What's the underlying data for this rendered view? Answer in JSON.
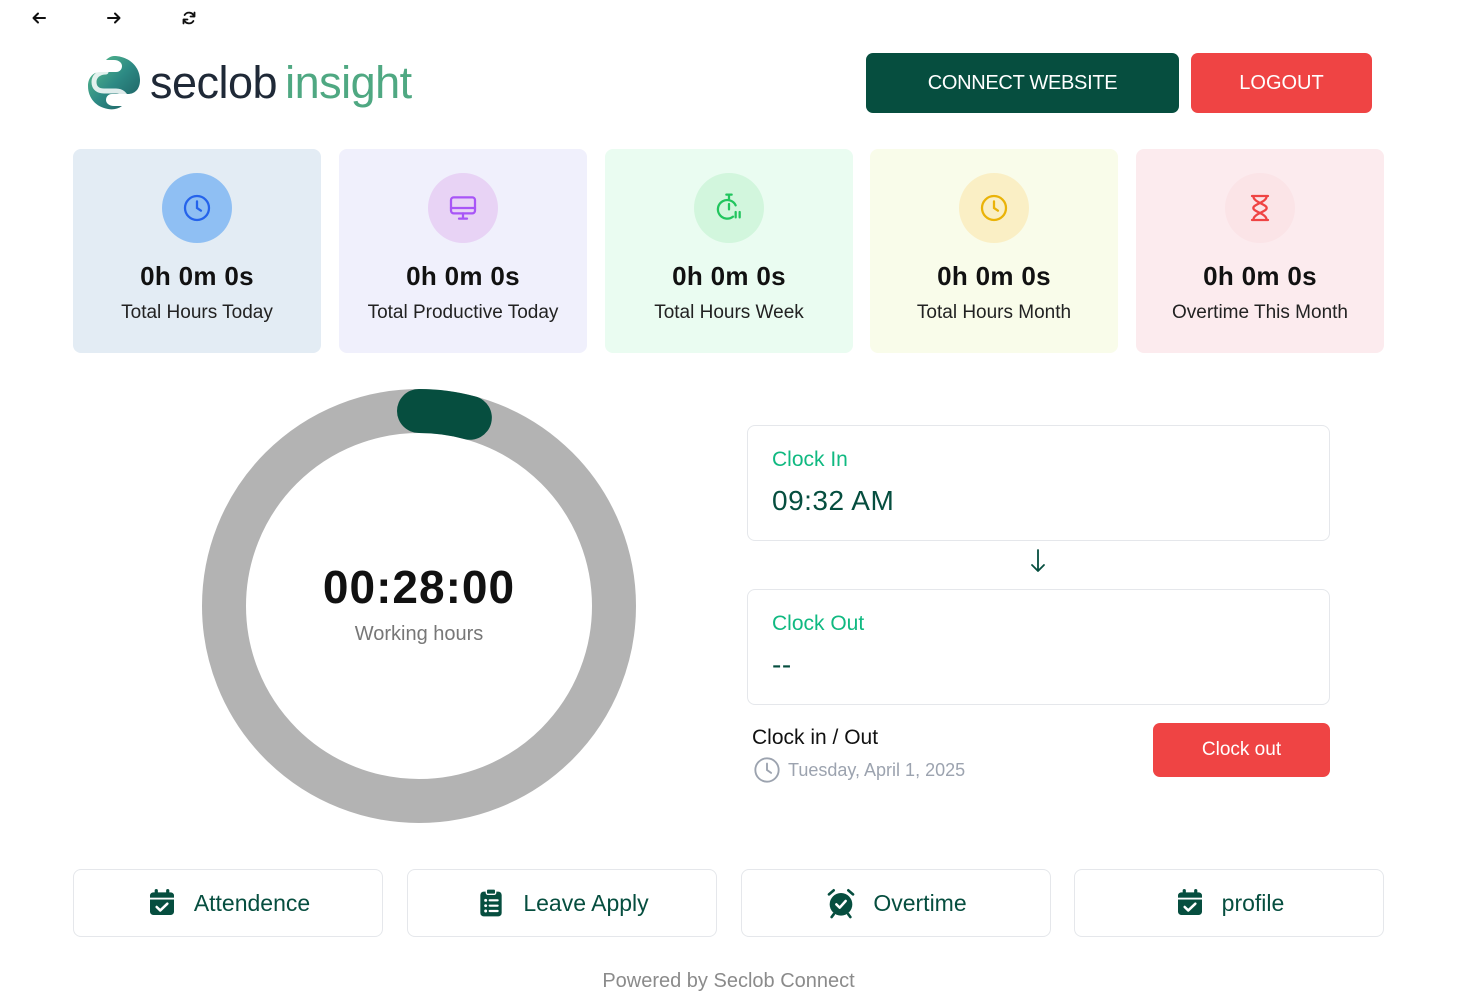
{
  "brand": {
    "name_part1": "seclob",
    "name_part2": "insight"
  },
  "header": {
    "connect_label": "CONNECT WEBSITE",
    "logout_label": "LOGOUT"
  },
  "stats": [
    {
      "value": "0h 0m 0s",
      "label": "Total Hours Today",
      "icon": "clock-icon"
    },
    {
      "value": "0h 0m 0s",
      "label": "Total Productive Today",
      "icon": "monitor-icon"
    },
    {
      "value": "0h 0m 0s",
      "label": "Total Hours Week",
      "icon": "stopwatch-icon"
    },
    {
      "value": "0h 0m 0s",
      "label": "Total Hours Month",
      "icon": "clock-icon"
    },
    {
      "value": "0h 0m 0s",
      "label": "Overtime This Month",
      "icon": "hourglass-icon"
    }
  ],
  "timer": {
    "time": "00:28:00",
    "label": "Working hours",
    "progress_fraction": 0.042
  },
  "clock_in": {
    "label": "Clock In",
    "value": "09:32 AM"
  },
  "clock_out": {
    "label": "Clock Out",
    "value": "--"
  },
  "punch": {
    "title": "Clock in / Out",
    "date": "Tuesday, April 1, 2025",
    "button_label": "Clock out"
  },
  "quick_links": [
    {
      "label": "Attendence",
      "icon": "calendar-check-icon"
    },
    {
      "label": "Leave Apply",
      "icon": "clipboard-list-icon"
    },
    {
      "label": "Overtime",
      "icon": "alarm-clock-icon"
    },
    {
      "label": "profile",
      "icon": "calendar-check-icon"
    }
  ],
  "footer": {
    "text": "Powered by Seclob Connect"
  },
  "colors": {
    "primary": "#064e3f",
    "danger": "#ef4444",
    "accent_green": "#10b981",
    "ring_track": "#b3b3b3",
    "card_blue": "#e3ecf4",
    "card_purple": "#f0f0fc",
    "card_green": "#eafcf1",
    "card_yellow": "#f9fcea",
    "card_pink": "#fcebee"
  }
}
